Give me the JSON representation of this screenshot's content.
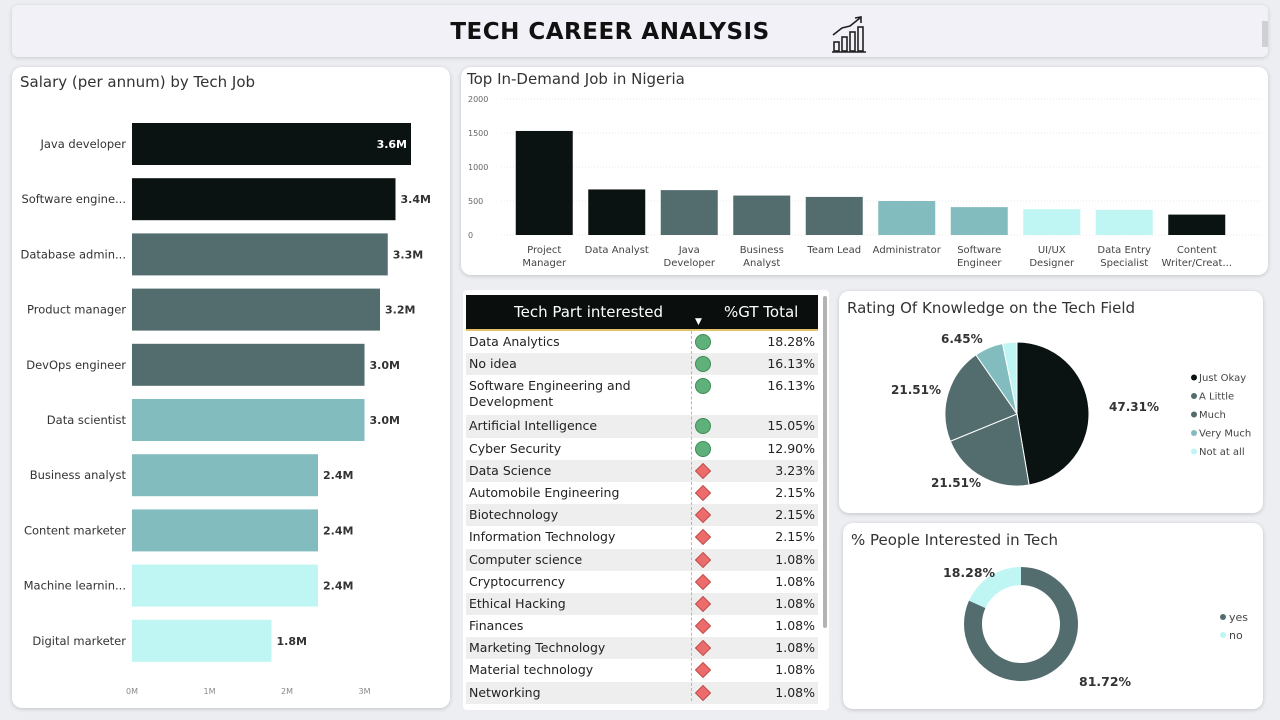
{
  "header": {
    "title": "TECH CAREER ANALYSIS",
    "icon": "bar-chart-growth-icon"
  },
  "salary": {
    "title": "Salary (per annum) by Tech Job",
    "chart_data": {
      "type": "bar",
      "orientation": "horizontal",
      "categories": [
        "Java developer",
        "Software engine...",
        "Database admin...",
        "Product manager",
        "DevOps engineer",
        "Data scientist",
        "Business analyst",
        "Content marketer",
        "Machine learnin...",
        "Digital marketer"
      ],
      "values": [
        3.6,
        3.4,
        3.3,
        3.2,
        3.0,
        3.0,
        2.4,
        2.4,
        2.4,
        1.8
      ],
      "value_labels": [
        "3.6M",
        "3.4M",
        "3.3M",
        "3.2M",
        "3.0M",
        "3.0M",
        "2.4M",
        "2.4M",
        "2.4M",
        "1.8M"
      ],
      "colors": [
        "#0b1312",
        "#0b1312",
        "#536c6e",
        "#536c6e",
        "#536c6e",
        "#83bcbe",
        "#83bcbe",
        "#83bcbe",
        "#bff6f4",
        "#bff6f4"
      ],
      "xticks": [
        "0M",
        "1M",
        "2M",
        "3M"
      ],
      "xlim": [
        0,
        3.7
      ],
      "unit": "M"
    }
  },
  "demand": {
    "title": "Top In-Demand Job in Nigeria",
    "chart_data": {
      "type": "bar",
      "categories": [
        [
          "Project",
          "Manager"
        ],
        [
          "Data Analyst"
        ],
        [
          "Java",
          "Developer"
        ],
        [
          "Business",
          "Analyst"
        ],
        [
          "Team Lead"
        ],
        [
          "Administrator"
        ],
        [
          "Software",
          "Engineer"
        ],
        [
          "UI/UX",
          "Designer"
        ],
        [
          "Data Entry",
          "Specialist"
        ],
        [
          "Content",
          "Writer/Creat..."
        ]
      ],
      "values": [
        1530,
        670,
        660,
        580,
        560,
        500,
        410,
        380,
        370,
        300
      ],
      "colors": [
        "#0b1312",
        "#0b1312",
        "#536c6e",
        "#536c6e",
        "#536c6e",
        "#83bcbe",
        "#83bcbe",
        "#bff6f4",
        "#bff6f4",
        "#0b1312"
      ],
      "yticks": [
        "2000",
        "1500",
        "1000",
        "500",
        "0"
      ],
      "ylim": [
        0,
        2000
      ]
    }
  },
  "table": {
    "col1": "Tech Part interested",
    "col2": "%GT Total",
    "rows": [
      {
        "name": "Data Analytics",
        "value": "18.28%",
        "icon": "green-circle-icon"
      },
      {
        "name": "No idea",
        "value": "16.13%",
        "icon": "green-circle-icon"
      },
      {
        "name": "Software Engineering and Development",
        "value": "16.13%",
        "icon": "green-circle-icon"
      },
      {
        "name": "Artificial Intelligence",
        "value": "15.05%",
        "icon": "green-circle-icon"
      },
      {
        "name": "Cyber Security",
        "value": "12.90%",
        "icon": "green-circle-icon"
      },
      {
        "name": "Data Science",
        "value": "3.23%",
        "icon": "red-diamond-icon"
      },
      {
        "name": "Automobile Engineering",
        "value": "2.15%",
        "icon": "red-diamond-icon"
      },
      {
        "name": "Biotechnology",
        "value": "2.15%",
        "icon": "red-diamond-icon"
      },
      {
        "name": "Information Technology",
        "value": "2.15%",
        "icon": "red-diamond-icon"
      },
      {
        "name": "Computer science",
        "value": "1.08%",
        "icon": "red-diamond-icon"
      },
      {
        "name": "Cryptocurrency",
        "value": "1.08%",
        "icon": "red-diamond-icon"
      },
      {
        "name": "Ethical Hacking",
        "value": "1.08%",
        "icon": "red-diamond-icon"
      },
      {
        "name": "Finances",
        "value": "1.08%",
        "icon": "red-diamond-icon"
      },
      {
        "name": "Marketing Technology",
        "value": "1.08%",
        "icon": "red-diamond-icon"
      },
      {
        "name": "Material technology",
        "value": "1.08%",
        "icon": "red-diamond-icon"
      },
      {
        "name": "Networking",
        "value": "1.08%",
        "icon": "red-diamond-icon"
      }
    ]
  },
  "rating": {
    "title": "Rating Of Knowledge on the Tech Field",
    "chart_data": {
      "type": "pie",
      "labels": [
        "Just Okay",
        "A Little",
        "Much",
        "Very Much",
        "Not at all"
      ],
      "values": [
        47.31,
        21.51,
        21.51,
        6.45,
        3.22
      ],
      "value_labels": [
        "47.31%",
        "21.51%",
        "21.51%",
        "6.45%",
        ""
      ],
      "colors": [
        "#0b1312",
        "#536c6e",
        "#536c6e",
        "#83bcbe",
        "#bff6f4"
      ],
      "legend_position": "right"
    }
  },
  "interest": {
    "title": "% People Interested in Tech",
    "chart_data": {
      "type": "pie",
      "donut": true,
      "labels": [
        "yes",
        "no"
      ],
      "values": [
        81.72,
        18.28
      ],
      "value_labels": [
        "81.72%",
        "18.28%"
      ],
      "colors": [
        "#536c6e",
        "#bff6f4"
      ],
      "legend_position": "right"
    }
  }
}
